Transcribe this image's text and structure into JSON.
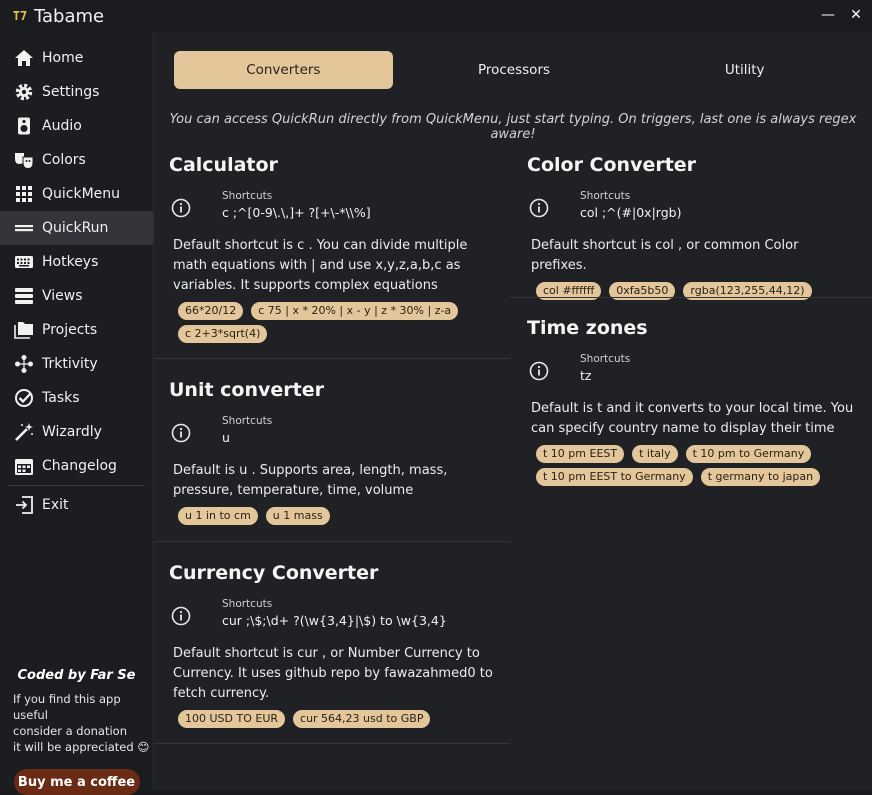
{
  "app": {
    "title": "Tabame",
    "logo_text": "T7"
  },
  "window_controls": {
    "minimize": "—",
    "close": "✕"
  },
  "sidebar": {
    "items": [
      {
        "label": "Home",
        "icon": "home-icon"
      },
      {
        "label": "Settings",
        "icon": "gear-icon"
      },
      {
        "label": "Audio",
        "icon": "speaker-icon"
      },
      {
        "label": "Colors",
        "icon": "theater-masks-icon"
      },
      {
        "label": "QuickMenu",
        "icon": "grid-icon"
      },
      {
        "label": "QuickRun",
        "icon": "menu-lines-icon",
        "active": true
      },
      {
        "label": "Hotkeys",
        "icon": "keyboard-icon"
      },
      {
        "label": "Views",
        "icon": "list-icon"
      },
      {
        "label": "Projects",
        "icon": "folders-icon"
      },
      {
        "label": "Trktivity",
        "icon": "network-icon"
      },
      {
        "label": "Tasks",
        "icon": "check-circle-icon"
      },
      {
        "label": "Wizardly",
        "icon": "magic-wand-icon"
      },
      {
        "label": "Changelog",
        "icon": "calendar-icon"
      }
    ],
    "exit": {
      "label": "Exit",
      "icon": "exit-icon"
    },
    "credit": {
      "title": "Coded by Far Se",
      "line1": "If you find this app useful",
      "line2": "consider a donation",
      "line3": "it will be appreciated 😊",
      "button": "Buy me a coffee"
    }
  },
  "main": {
    "tabs": [
      {
        "label": "Converters",
        "active": true
      },
      {
        "label": "Processors"
      },
      {
        "label": "Utility"
      }
    ],
    "hint": "You can access QuickRun directly from QuickMenu, just start typing. On triggers, last one is always regex aware!",
    "shortcuts_label": "Shortcuts",
    "cards": {
      "calculator": {
        "title": "Calculator",
        "shortcut": "c ;^[0-9\\.\\,]+ ?[+\\-*\\\\%]",
        "description": "Default shortcut is c . You can divide multiple math equations with | and use x,y,z,a,b,c as variables. It supports complex equations",
        "examples": [
          "66*20/12",
          "c 75 | x * 20% | x - y | z * 30% | z-a",
          "c 2+3*sqrt(4)"
        ]
      },
      "unit": {
        "title": "Unit converter",
        "shortcut": "u",
        "description": "Default is u . Supports area, length, mass, pressure, temperature, time, volume",
        "examples": [
          "u 1 in to cm",
          "u 1 mass"
        ]
      },
      "currency": {
        "title": "Currency Converter",
        "shortcut": "cur ;\\$;\\d+ ?(\\w{3,4}|\\$) to \\w{3,4}",
        "description": "Default shortcut is cur , or Number Currency to Currency. It uses github repo by fawazahmed0 to fetch currency.",
        "examples": [
          "100 USD TO EUR",
          "cur 564,23 usd to GBP"
        ]
      },
      "color": {
        "title": "Color Converter",
        "shortcut": "col ;^(#|0x|rgb)",
        "description": "Default shortcut is col , or common Color prefixes.",
        "examples": [
          "col #ffffff",
          "0xfa5b50",
          "rgba(123,255,44,12)"
        ]
      },
      "timezones": {
        "title": "Time zones",
        "shortcut": "tz",
        "description": "Default is t and it converts to your local time. You can specify country name to display their time",
        "examples": [
          "t 10 pm EEST",
          "t italy",
          "t 10 pm to Germany",
          "t 10 pm EEST to Germany",
          "t germany to japan"
        ]
      }
    }
  },
  "colors": {
    "accent": "#e3c69a",
    "coffee": "#6a2b14",
    "logo": "#e8c547"
  }
}
